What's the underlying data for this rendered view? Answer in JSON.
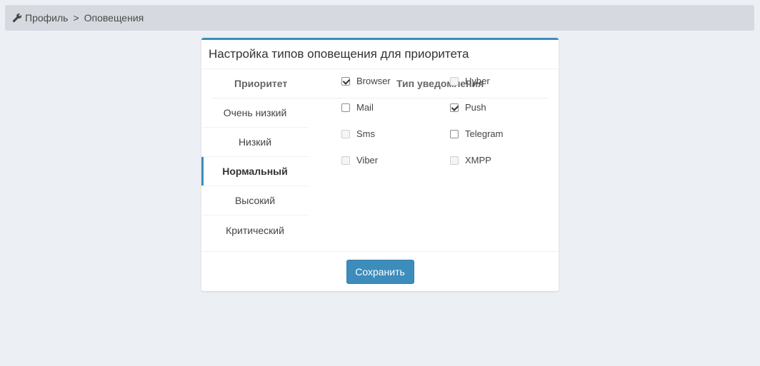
{
  "breadcrumb": {
    "icon": "wrench-icon",
    "profile": "Профиль",
    "separator": ">",
    "current": "Оповещения"
  },
  "panel": {
    "title": "Настройка типов оповещения для приоритета",
    "col_priority": "Приоритет",
    "col_type": "Тип уведомления",
    "priorities": [
      {
        "label": "Очень низкий",
        "active": false
      },
      {
        "label": "Низкий",
        "active": false
      },
      {
        "label": "Нормальный",
        "active": true
      },
      {
        "label": "Высокий",
        "active": false
      },
      {
        "label": "Критический",
        "active": false
      }
    ],
    "types": [
      {
        "label": "Browser",
        "checked": true,
        "disabled": false
      },
      {
        "label": "Hyber",
        "checked": false,
        "disabled": true
      },
      {
        "label": "Mail",
        "checked": false,
        "disabled": false
      },
      {
        "label": "Push",
        "checked": true,
        "disabled": false
      },
      {
        "label": "Sms",
        "checked": false,
        "disabled": true
      },
      {
        "label": "Telegram",
        "checked": false,
        "disabled": false
      },
      {
        "label": "Viber",
        "checked": false,
        "disabled": true
      },
      {
        "label": "XMPP",
        "checked": false,
        "disabled": true
      }
    ],
    "save_label": "Сохранить"
  },
  "colors": {
    "accent": "#3c8dbc",
    "background": "#eceff4",
    "breadcrumb_bg": "#d6d9e0"
  }
}
